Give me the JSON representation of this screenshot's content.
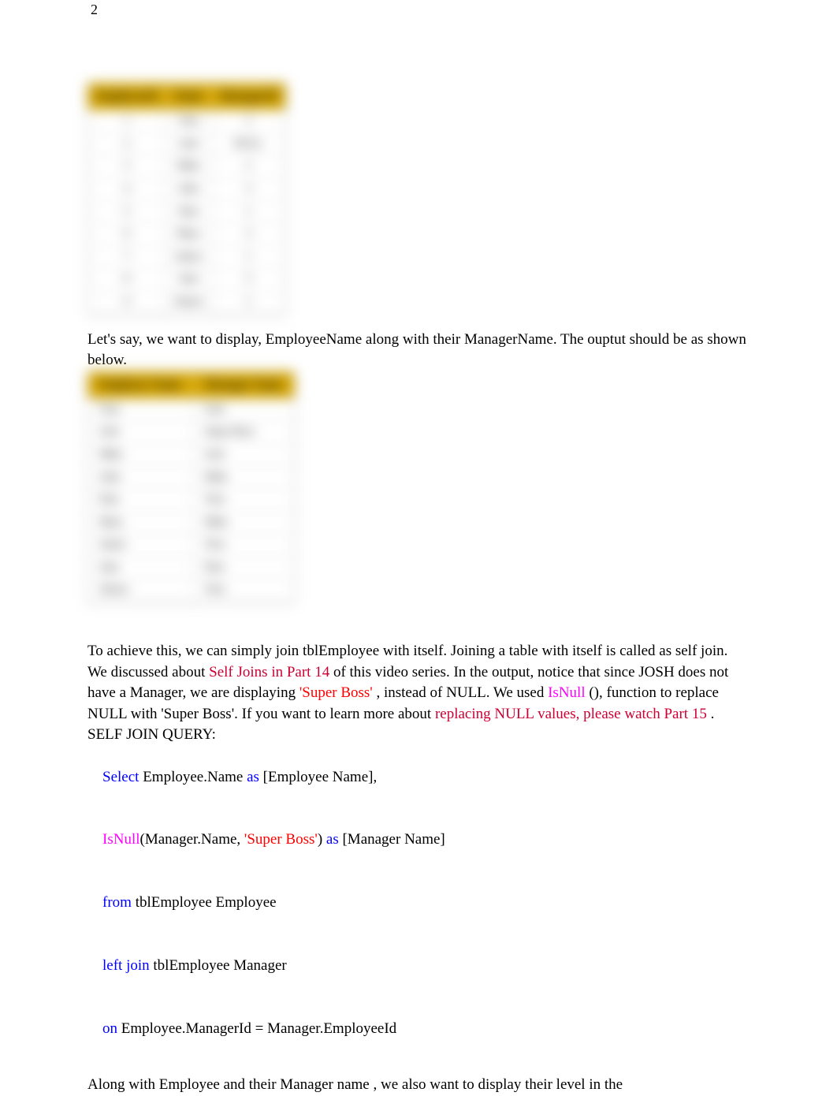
{
  "page_number": "2",
  "table1": {
    "headers": [
      "EmployeeId",
      "Name",
      "ManagerId"
    ],
    "rows": [
      [
        "1",
        "Tom",
        "2"
      ],
      [
        "2",
        "Josh",
        "NULL"
      ],
      [
        "3",
        "Mike",
        "2"
      ],
      [
        "4",
        "John",
        "3"
      ],
      [
        "5",
        "Pam",
        "1"
      ],
      [
        "6",
        "Mary",
        "3"
      ],
      [
        "7",
        "James",
        "1"
      ],
      [
        "8",
        "Sam",
        "5"
      ],
      [
        "9",
        "Simon",
        "1"
      ]
    ]
  },
  "para1": {
    "text1": "Let's say, we want to display, EmployeeName along with their ManagerName",
    "text2": ". The ouptut should be as shown below."
  },
  "table2": {
    "headers": [
      "Employee Name",
      "Manager Name"
    ],
    "rows": [
      [
        "Tom",
        "Josh"
      ],
      [
        "Josh",
        "Super Boss"
      ],
      [
        "Mike",
        "Josh"
      ],
      [
        "John",
        "Mike"
      ],
      [
        "Pam",
        "Tom"
      ],
      [
        "Mary",
        "Mike"
      ],
      [
        "James",
        "Tom"
      ],
      [
        "Sam",
        "Pam"
      ],
      [
        "Simon",
        "Tom"
      ]
    ]
  },
  "para2": {
    "t1": "To achieve this, we can simply join tblEmployee with itself.",
    "t2": "Joining a table with itself is called as self join. We discussed about ",
    "link1": "Self Joins in Part 14",
    "t3": " of this video series. In the output, notice that since ",
    "josh": "JOSH",
    "t4": " does not have a Manager, we are displaying ",
    "superboss": "'Super Boss'",
    "t5": ", instead of ",
    "null_text": "NULL. We used ",
    "isnull": "IsNull",
    "t6": "(), function to replace NULL with 'Super Boss'. If you want to learn more about ",
    "link2": "replacing NULL values, please watch Part 15",
    "t7": "."
  },
  "query_title": "SELF JOIN QUERY:",
  "query": {
    "select": "Select",
    "emp_name": " Employee.Name ",
    "as1": "as",
    "emp_alias": " [Employee Name],",
    "isnull_fn": "IsNull",
    "mgr_name": "(Manager.Name, ",
    "sb_str": "'Super Boss'",
    "close_paren": ") ",
    "as2": "as",
    "mgr_alias": " [Manager Name]",
    "from": "from",
    "from_tbl": " tblEmployee Employee",
    "leftjoin": "left join",
    "lj_tbl": " tblEmployee Manager",
    "on": "on",
    "on_cond": " Employee.ManagerId = Manager.EmployeeId"
  },
  "para3": {
    "t1": "Along with Employee and their Manager name",
    "t2": ", we also want to display their level in the"
  }
}
